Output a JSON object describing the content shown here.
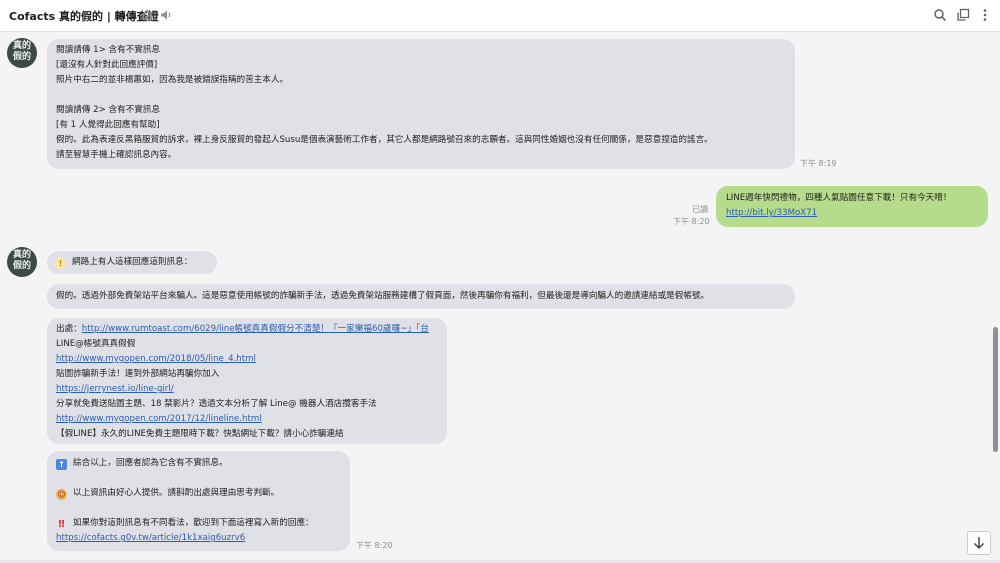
{
  "header": {
    "title": "Cofacts 真的假的 | 轉傳查證"
  },
  "bot": {
    "avatar_text_line1": "真的",
    "avatar_text_line2": "假的"
  },
  "msg1": {
    "lines": [
      "閱讀請傳 1> 含有不實訊息",
      "[還沒有人針對此回應評價]",
      "照片中右二的並非楊蕙如，因為我是被錯誤指稱的苦主本人。",
      "",
      "閱讀請傳 2> 含有不實訊息",
      "[有 1 人覺得此回應有幫助]",
      "假的。此為表達反黑箱服貿的訴求，裸上身反服貿的發起人Susu是個表演藝術工作者，其它人都是網路號召來的志願者。這與同性婚姻也沒有任何關係，是惡意捏造的謠言。",
      "請至智慧手機上確認訊息內容。"
    ],
    "time": "下午 8:19"
  },
  "msg2": {
    "text": "LINE週年快閃禮物，四種人氣貼圖任意下載！只有今天唷！",
    "link": "http://bit.ly/33MoX71",
    "read": "已讀",
    "time": "下午 8:20"
  },
  "msg3": {
    "text": "網路上有人這樣回應這則訊息："
  },
  "msg4": {
    "text": "假的。透過外部免費架站平台來騙人。這是惡意使用帳號的詐騙新手法，透過免費架站服務建構了假頁面，然後再騙你有福利，但最後還是導向騙人的邀請連結或是假帳號。"
  },
  "msg5": {
    "prefix": "出處：",
    "first_link": "http://www.rumtoast.com/6029/line帳號真真假假分不清楚！「一家樂福60歲囉~」「台",
    "rows": [
      "LINE@帳號真真假假",
      "http://www.mygopen.com/2018/05/line_4.html",
      "貼圖詐騙新手法！連到外部網站再騙你加入",
      "https://jerrynest.io/line-girl/",
      "分享就免費送貼圖主題、18 禁影片？透過文本分析了解 Line@ 機器人酒店攬客手法",
      "http://www.mygopen.com/2017/12/lineline.html",
      "【假LINE】永久的LINE免費主題限時下載？快點網址下載？請小心詐騙連結"
    ]
  },
  "msg6": {
    "line1": "綜合以上，回應者認為它含有不實訊息。",
    "line2": "以上資訊由好心人提供。請斟酌出處與理由思考判斷。",
    "line3": "如果你對這則訊息有不同看法，歡迎到下面這裡寫入新的回應：",
    "link": "https://cofacts.g0v.tw/article/1k1xaig6uzrv6",
    "time": "下午 8:20"
  },
  "colors": {
    "incoming_bubble": "#dfe1e6",
    "outgoing_bubble": "#b6dc8b",
    "link": "#2a5db0",
    "avatar": "#3f4a47"
  },
  "icons": [
    "home-icon",
    "speaker-icon",
    "search-icon",
    "copy-icon",
    "more-options-icon",
    "arrow-down-icon",
    "lightbulb-emoji-icon",
    "up-arrow-emoji-icon",
    "person-emoji-icon",
    "exclamation-emoji-icon"
  ]
}
